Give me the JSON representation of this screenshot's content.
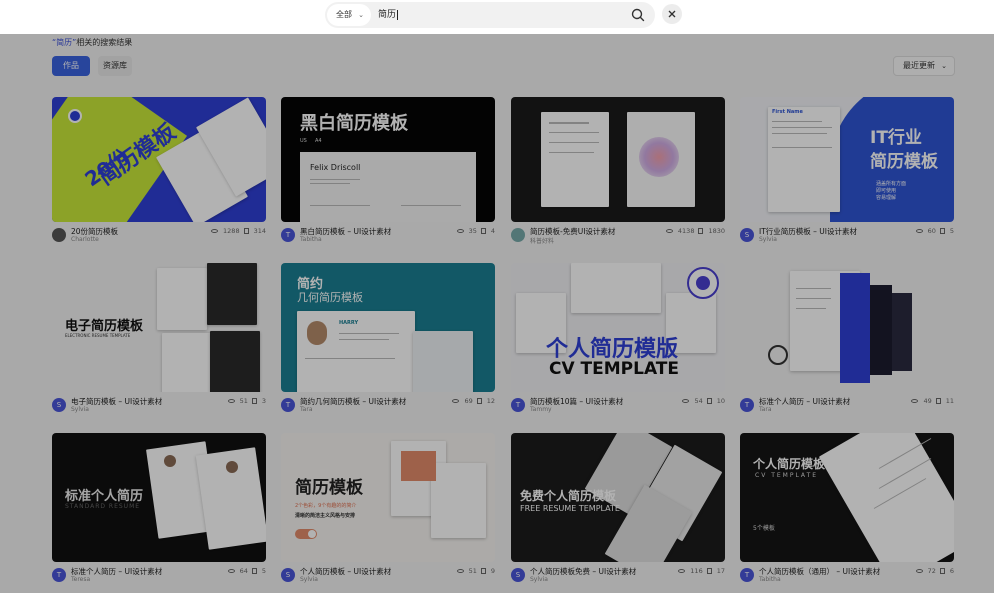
{
  "search": {
    "scope_label": "全部",
    "query": "简历",
    "result_prefix": "“简历”",
    "result_suffix": "相关的搜索结果"
  },
  "tabs": [
    {
      "label": "作品",
      "active": true
    },
    {
      "label": "资源库",
      "active": false
    }
  ],
  "sort_label": "最近更新",
  "cards": [
    {
      "title": "20份简历模板",
      "author": "Charlotte",
      "views": "1288",
      "likes": "314",
      "avatar_letter": "",
      "thumb_text": [
        "20份",
        "简历模板"
      ]
    },
    {
      "title": "黑白简历模板 – UI设计素材",
      "author": "Tabitha",
      "views": "35",
      "likes": "4",
      "avatar_letter": "T",
      "thumb_text": [
        "黑白简历模板",
        "US",
        "A4",
        "Felix Driscoll"
      ]
    },
    {
      "title": "简历模板-免费UI设计素材",
      "author": "科普好料",
      "views": "4138",
      "likes": "1830",
      "avatar_letter": "",
      "thumb_text": []
    },
    {
      "title": "IT行业简历模板 – UI设计素材",
      "author": "Sylvia",
      "views": "60",
      "likes": "5",
      "avatar_letter": "S",
      "thumb_text": [
        "IT行业",
        "简历模板",
        "First Name",
        "涵盖所有方面",
        "即可使用",
        "容易理解"
      ]
    },
    {
      "title": "电子简历模板 – UI设计素材",
      "author": "Sylvia",
      "views": "51",
      "likes": "3",
      "avatar_letter": "S",
      "thumb_text": [
        "电子简历模板",
        "ELECTRONIC RESUME TEMPLATE"
      ]
    },
    {
      "title": "简约几何简历模板 – UI设计素材",
      "author": "Tara",
      "views": "69",
      "likes": "12",
      "avatar_letter": "T",
      "thumb_text": [
        "简约",
        "几何简历模板",
        "HARRY"
      ]
    },
    {
      "title": "简历模板10篇 – UI设计素材",
      "author": "Tammy",
      "views": "54",
      "likes": "10",
      "avatar_letter": "T",
      "thumb_text": [
        "个人简历模版",
        "CV TEMPLATE"
      ]
    },
    {
      "title": "标准个人简历 – UI设计素材",
      "author": "Tara",
      "views": "49",
      "likes": "11",
      "avatar_letter": "T",
      "thumb_text": []
    },
    {
      "title": "标准个人简历 – UI设计素材",
      "author": "Teresa",
      "views": "64",
      "likes": "5",
      "avatar_letter": "T",
      "thumb_text": [
        "标准个人简历",
        "STANDARD RESUME"
      ]
    },
    {
      "title": "个人简历模板 – UI设计素材",
      "author": "Sylvia",
      "views": "51",
      "likes": "9",
      "avatar_letter": "S",
      "thumb_text": [
        "简历模板",
        "2个色彩，9个有趣的的简介",
        "清晰的简洁主义风格与安排"
      ]
    },
    {
      "title": "个人简历模板免费 – UI设计素材",
      "author": "Sylvia",
      "views": "116",
      "likes": "17",
      "avatar_letter": "S",
      "thumb_text": [
        "免费个人简历模板",
        "FREE RESUME TEMPLATE"
      ]
    },
    {
      "title": "个人简历模板（通用） – UI设计素材",
      "author": "Tabitha",
      "views": "72",
      "likes": "6",
      "avatar_letter": "T",
      "thumb_text": [
        "个人简历模板",
        "CV TEMPLATE",
        "5个模板"
      ]
    }
  ],
  "colors": {
    "accent": "#3a63e0",
    "blue_thumb": "#2f3fd6",
    "teal_thumb": "#1a7f93"
  }
}
